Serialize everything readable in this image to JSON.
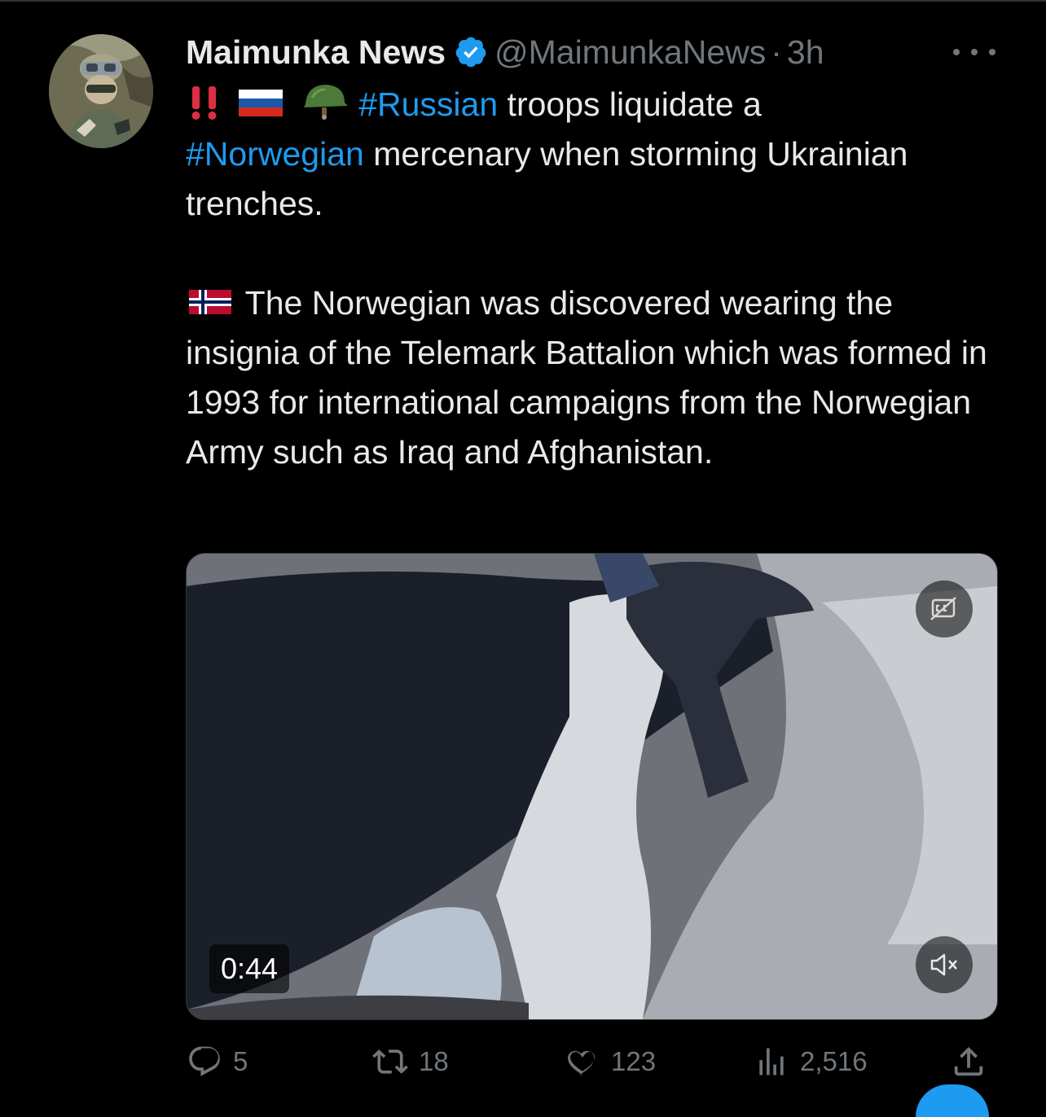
{
  "tweet": {
    "author_name": "Maimunka News",
    "handle": "@MaimunkaNews",
    "separator": "·",
    "time": "3h",
    "emojis": [
      "double-exclamation-icon",
      "russia-flag-icon",
      "military-helmet-icon",
      "norway-flag-icon"
    ],
    "text": {
      "hashtag_russian": "#Russian",
      "line1_rest": " troops liquidate a",
      "hashtag_norwegian": "#Norwegian",
      "line2_rest": " mercenary when storming Ukrainian trenches.",
      "paragraph2": " The Norwegian was discovered wearing the insignia of the Telemark Battalion which was formed in 1993 for international campaigns from the Norwegian Army such as Iraq and Afghanistan."
    }
  },
  "media": {
    "duration": "0:44",
    "captions_icon": "captions-off-icon",
    "mute_icon": "volume-muted-icon"
  },
  "actions": {
    "replies": "5",
    "retweets": "18",
    "likes": "123",
    "views": "2,516"
  },
  "colors": {
    "background": "#000000",
    "text": "#e7e9ea",
    "secondary": "#71767b",
    "link": "#1d9bf0",
    "verified": "#1d9bf0"
  }
}
